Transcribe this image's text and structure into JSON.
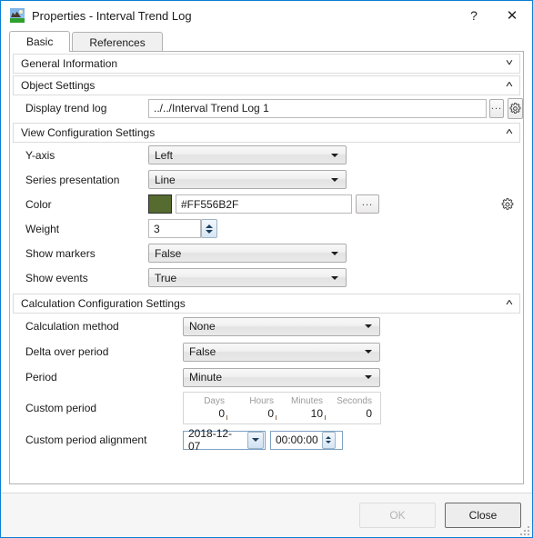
{
  "window": {
    "title": "Properties - Interval Trend Log",
    "icon": "trend-log-image-icon",
    "help_label": "?",
    "close_label": "✕",
    "border_color": "#0a7fd4"
  },
  "tabs": [
    {
      "label": "Basic",
      "active": true
    },
    {
      "label": "References",
      "active": false
    }
  ],
  "sections": {
    "general_information": {
      "title": "General Information",
      "chevron": "˅",
      "expanded": false
    },
    "object_settings": {
      "title": "Object Settings",
      "chevron": "˄",
      "expanded": true
    },
    "view_configuration": {
      "title": "View Configuration Settings",
      "chevron": "˄",
      "expanded": true
    },
    "calculation_configuration": {
      "title": "Calculation Configuration Settings",
      "chevron": "˄",
      "expanded": true
    }
  },
  "object_settings": {
    "display_trend_log": {
      "label": "Display trend log",
      "value": "../../Interval Trend Log 1",
      "browse_label": "...",
      "gear_icon": "gear-icon"
    }
  },
  "view_configuration": {
    "y_axis": {
      "label": "Y-axis",
      "value": "Left"
    },
    "series_presentation": {
      "label": "Series presentation",
      "value": "Line"
    },
    "color": {
      "label": "Color",
      "value": "#FF556B2F",
      "swatch_hex": "#556B2F",
      "browse_label": "...",
      "gear_icon": "gear-icon"
    },
    "weight": {
      "label": "Weight",
      "value": "3"
    },
    "show_markers": {
      "label": "Show markers",
      "value": "False"
    },
    "show_events": {
      "label": "Show events",
      "value": "True"
    }
  },
  "calculation_configuration": {
    "calculation_method": {
      "label": "Calculation method",
      "value": "None"
    },
    "delta_over_period": {
      "label": "Delta over period",
      "value": "False"
    },
    "period": {
      "label": "Period",
      "value": "Minute"
    },
    "custom_period": {
      "label": "Custom period",
      "columns": [
        "Days",
        "Hours",
        "Minutes",
        "Seconds"
      ],
      "values": [
        "0",
        "0",
        "10",
        "0"
      ]
    },
    "custom_period_alignment": {
      "label": "Custom period alignment",
      "date": "2018-12-07",
      "time": "00:00:00"
    }
  },
  "footer": {
    "ok_label": "OK",
    "ok_enabled": false,
    "close_label": "Close",
    "close_enabled": true
  }
}
